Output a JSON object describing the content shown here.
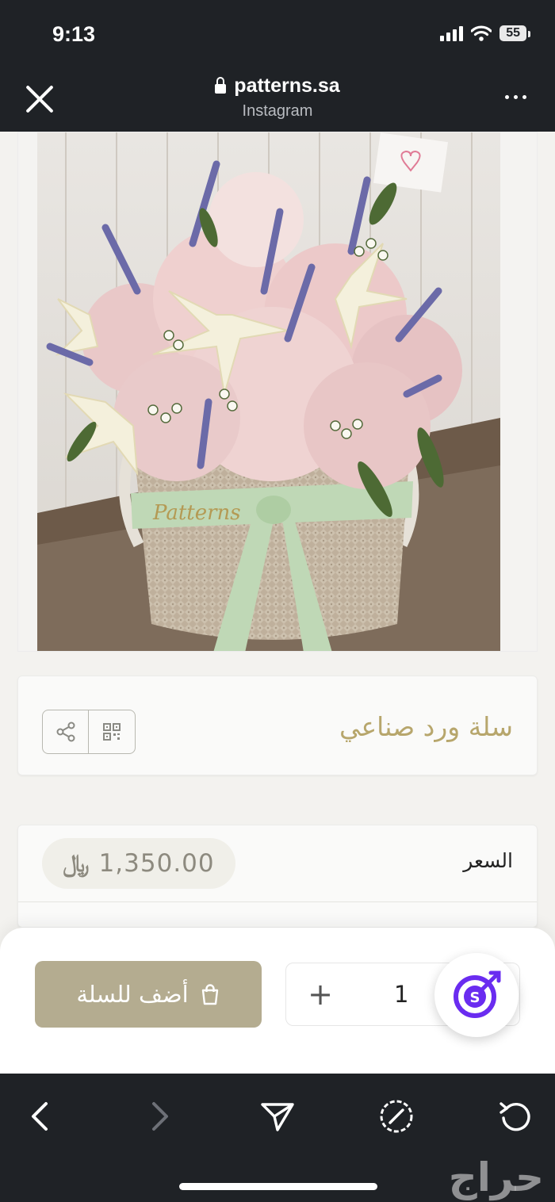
{
  "status_bar": {
    "time": "9:13",
    "battery": "55"
  },
  "browser": {
    "domain": "patterns.sa",
    "subtitle": "Instagram"
  },
  "product": {
    "title": "سلة ورد صناعي",
    "price_label": "السعر",
    "price": "1,350.00",
    "currency_symbol": "﷼",
    "ribbon_brand": "Patterns"
  },
  "cart": {
    "add_label": "أضف للسلة",
    "quantity": "1",
    "plus_symbol": "+"
  },
  "watermark": "حراج",
  "colors": {
    "brand_gold": "#b7a66c",
    "button_bg": "#b4ac90",
    "dark_bar": "#1f2226",
    "fab_purple": "#6a2cf0"
  },
  "icons": {
    "close": "close-icon",
    "lock": "lock-icon",
    "more": "more-dots-icon",
    "share": "share-icon",
    "qr": "qr-code-icon",
    "bag": "shopping-bag-icon",
    "fab": "target-s-icon",
    "back": "back-chevron-icon",
    "forward": "forward-chevron-icon",
    "send": "send-icon",
    "safari": "compass-icon",
    "reload": "reload-icon"
  }
}
